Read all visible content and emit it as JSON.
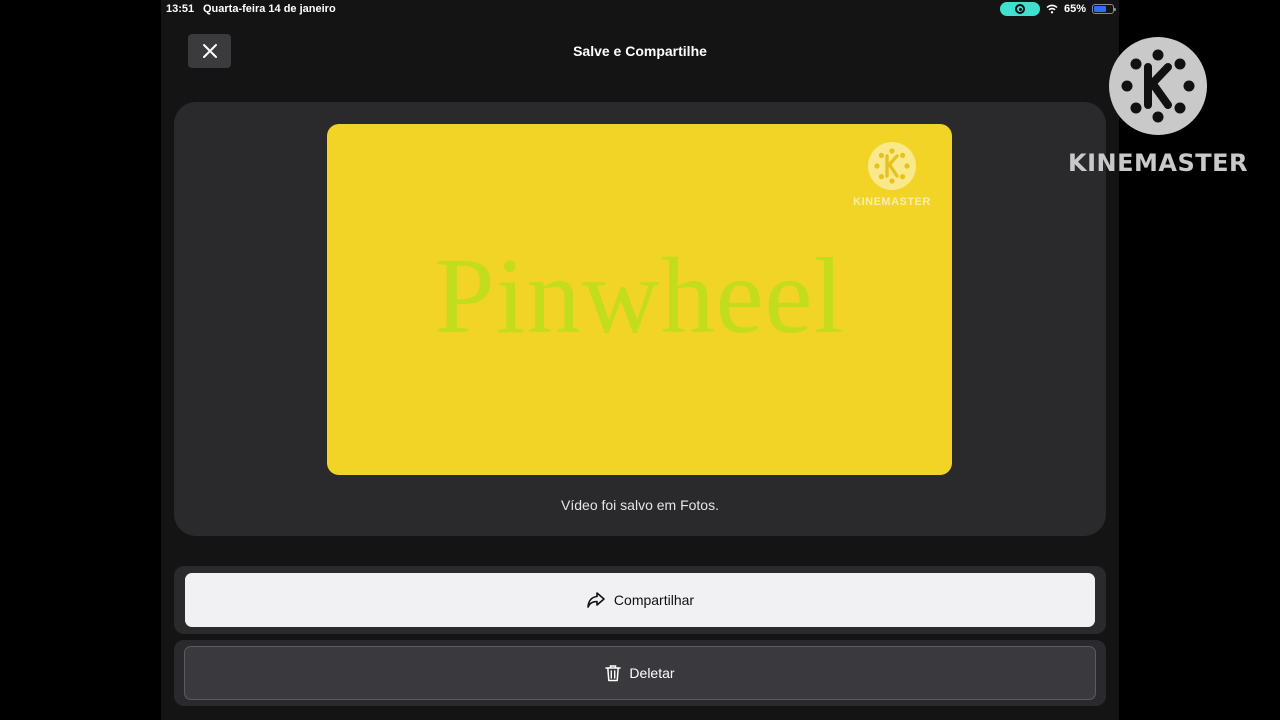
{
  "status_bar": {
    "time": "13:51",
    "date": "Quarta-feira 14 de janeiro",
    "battery": "65%",
    "battery_level": 0.65
  },
  "header": {
    "title": "Salve e Compartilhe"
  },
  "preview": {
    "video_title": "Pinwheel",
    "watermark": "KINEMASTER",
    "background_color": "#f2d426",
    "text_color": "#c3dc1e"
  },
  "saved_message": "Vídeo foi salvo em Fotos.",
  "actions": {
    "share_label": "Compartilhar",
    "delete_label": "Deletar"
  },
  "overlay": {
    "logo_text": "KINEMASTER"
  },
  "icons": {
    "close": "close-icon",
    "share": "share-arrow-icon",
    "delete": "trash-icon",
    "logo": "kinemaster-k-icon"
  }
}
